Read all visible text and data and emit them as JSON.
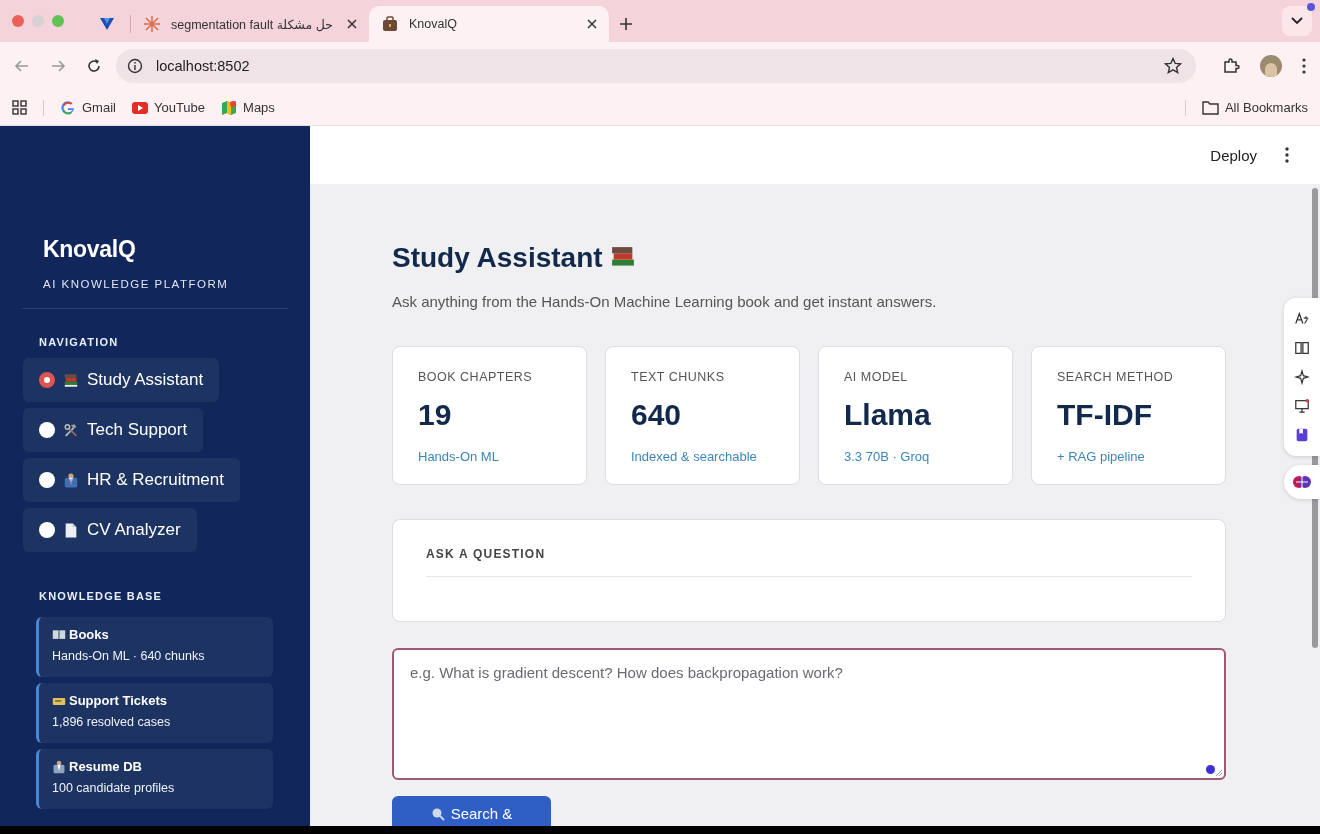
{
  "browser": {
    "tabs": [
      {
        "selected": false
      },
      {
        "title": "حل مشكلة segmentation fault",
        "selected": false
      },
      {
        "title": "KnovalQ",
        "selected": true
      }
    ],
    "address": "localhost:8502",
    "bookmarks": [
      "Gmail",
      "YouTube",
      "Maps"
    ],
    "all_bookmarks": "All Bookmarks"
  },
  "sidebar": {
    "brand": "KnovalQ",
    "tagline": "AI KNOWLEDGE PLATFORM",
    "nav_heading": "NAVIGATION",
    "nav": [
      {
        "label": "Study Assistant",
        "selected": true
      },
      {
        "label": "Tech Support",
        "selected": false
      },
      {
        "label": "HR & Recruitment",
        "selected": false
      },
      {
        "label": "CV Analyzer",
        "selected": false
      }
    ],
    "kb_heading": "KNOWLEDGE BASE",
    "kb": [
      {
        "title": "Books",
        "detail": "Hands-On ML · 640 chunks"
      },
      {
        "title": "Support Tickets",
        "detail": "1,896 resolved cases"
      },
      {
        "title": "Resume DB",
        "detail": "100 candidate profiles"
      }
    ]
  },
  "header": {
    "deploy": "Deploy"
  },
  "page": {
    "title": "Study Assistant",
    "subtitle": "Ask anything from the Hands-On Machine Learning book and get instant answers.",
    "stats": [
      {
        "label": "BOOK CHAPTERS",
        "value": "19",
        "note": "Hands-On ML"
      },
      {
        "label": "TEXT CHUNKS",
        "value": "640",
        "note": "Indexed & searchable"
      },
      {
        "label": "AI MODEL",
        "value": "Llama",
        "note": "3.3 70B · Groq"
      },
      {
        "label": "SEARCH METHOD",
        "value": "TF-IDF",
        "note": "+ RAG pipeline"
      }
    ],
    "question_heading": "ASK A QUESTION",
    "question": {
      "placeholder": "e.g. What is gradient descent? How does backpropagation work?"
    },
    "button": "Search &"
  }
}
